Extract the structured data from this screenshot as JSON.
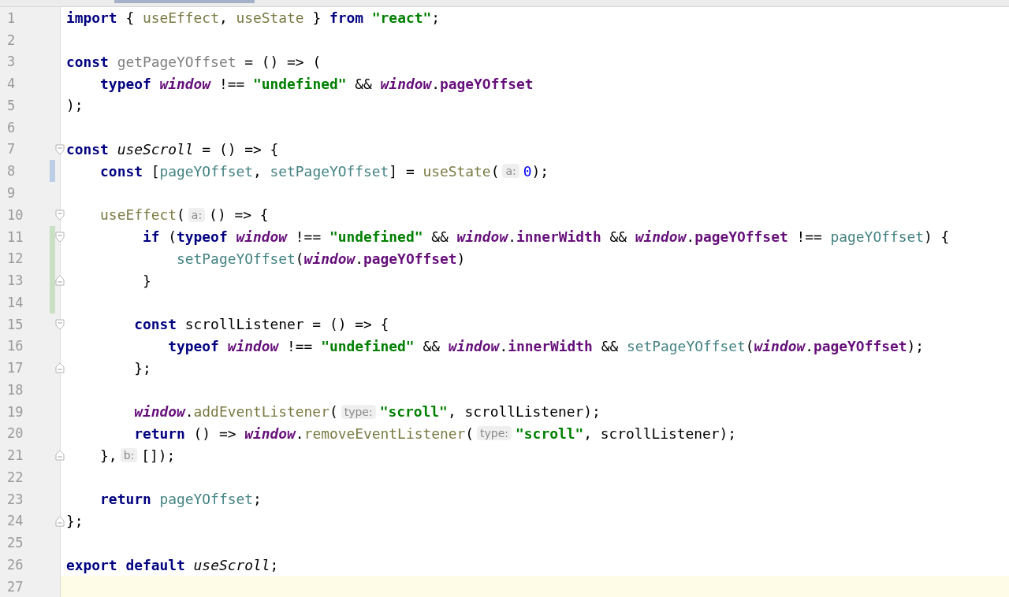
{
  "editor": {
    "lines": [
      {
        "number": "1",
        "tokens": [
          {
            "kind": "keyword",
            "text": "import"
          },
          {
            "kind": "plain",
            "text": " {"
          },
          {
            "kind": "function",
            "text": " useEffect"
          },
          {
            "kind": "plain",
            "text": ","
          },
          {
            "kind": "function",
            "text": " useState"
          },
          {
            "kind": "plain",
            "text": " }"
          },
          {
            "kind": "keyword",
            "text": " from"
          },
          {
            "kind": "string",
            "text": " \"react\""
          },
          {
            "kind": "plain",
            "text": ";"
          }
        ]
      },
      {
        "number": "2"
      },
      {
        "number": "3",
        "tokens": [
          {
            "kind": "keyword",
            "text": "const"
          },
          {
            "kind": "unused",
            "text": " getPageYOffset"
          },
          {
            "kind": "plain",
            "text": " = () => ("
          }
        ]
      },
      {
        "number": "4",
        "tokens": [
          {
            "kind": "keyword",
            "text": "    typeof"
          },
          {
            "kind": "global",
            "text": " window"
          },
          {
            "kind": "plain",
            "text": " !=="
          },
          {
            "kind": "string",
            "text": " \"undefined\""
          },
          {
            "kind": "plain",
            "text": " &&"
          },
          {
            "kind": "global",
            "text": " window"
          },
          {
            "kind": "plain",
            "text": "."
          },
          {
            "kind": "field",
            "text": "pageYOffset"
          }
        ]
      },
      {
        "number": "5",
        "tokens": [
          {
            "kind": "plain",
            "text": ");"
          }
        ]
      },
      {
        "number": "6"
      },
      {
        "number": "7",
        "fold_start": true,
        "tokens": [
          {
            "kind": "keyword",
            "text": "const"
          },
          {
            "kind": "italic",
            "text": " useScroll"
          },
          {
            "kind": "plain",
            "text": " = () => {"
          }
        ]
      },
      {
        "number": "8",
        "modified": true,
        "tokens": [
          {
            "kind": "keyword",
            "text": "    const"
          },
          {
            "kind": "plain",
            "text": " ["
          },
          {
            "kind": "local",
            "text": "pageYOffset"
          },
          {
            "kind": "plain",
            "text": ","
          },
          {
            "kind": "local",
            "text": " setPageYOffset"
          },
          {
            "kind": "plain",
            "text": "] ="
          },
          {
            "kind": "function",
            "text": " useState"
          },
          {
            "kind": "plain",
            "text": "("
          },
          {
            "kind": "hint",
            "text": "a:"
          },
          {
            "kind": "number",
            "text": "0"
          },
          {
            "kind": "plain",
            "text": ");"
          }
        ]
      },
      {
        "number": "9"
      },
      {
        "number": "10",
        "fold_start": true,
        "tokens": [
          {
            "kind": "function",
            "text": "    useEffect"
          },
          {
            "kind": "plain",
            "text": "("
          },
          {
            "kind": "hint",
            "text": "a:"
          },
          {
            "kind": "plain",
            "text": "() => {"
          }
        ]
      },
      {
        "number": "11",
        "added": true,
        "fold_start": true,
        "tokens": [
          {
            "kind": "keyword",
            "text": "         if"
          },
          {
            "kind": "plain",
            "text": " ("
          },
          {
            "kind": "keyword",
            "text": "typeof"
          },
          {
            "kind": "global",
            "text": " window"
          },
          {
            "kind": "plain",
            "text": " !=="
          },
          {
            "kind": "string",
            "text": " \"undefined\""
          },
          {
            "kind": "plain",
            "text": " &&"
          },
          {
            "kind": "global",
            "text": " window"
          },
          {
            "kind": "plain",
            "text": "."
          },
          {
            "kind": "field",
            "text": "innerWidth"
          },
          {
            "kind": "plain",
            "text": " &&"
          },
          {
            "kind": "global",
            "text": " window"
          },
          {
            "kind": "plain",
            "text": "."
          },
          {
            "kind": "field",
            "text": "pageYOffset"
          },
          {
            "kind": "plain",
            "text": " !=="
          },
          {
            "kind": "local",
            "text": " pageYOffset"
          },
          {
            "kind": "plain",
            "text": ") {"
          }
        ]
      },
      {
        "number": "12",
        "added": true,
        "tokens": [
          {
            "kind": "local",
            "text": "             setPageYOffset"
          },
          {
            "kind": "plain",
            "text": "("
          },
          {
            "kind": "global",
            "text": "window"
          },
          {
            "kind": "plain",
            "text": "."
          },
          {
            "kind": "field",
            "text": "pageYOffset"
          },
          {
            "kind": "plain",
            "text": ")"
          }
        ]
      },
      {
        "number": "13",
        "added": true,
        "fold_end": true,
        "tokens": [
          {
            "kind": "plain",
            "text": "         }"
          }
        ]
      },
      {
        "number": "14",
        "added": true
      },
      {
        "number": "15",
        "fold_start": true,
        "tokens": [
          {
            "kind": "keyword",
            "text": "        const"
          },
          {
            "kind": "plain",
            "text": " scrollListener = () => {"
          }
        ]
      },
      {
        "number": "16",
        "tokens": [
          {
            "kind": "keyword",
            "text": "            typeof"
          },
          {
            "kind": "global",
            "text": " window"
          },
          {
            "kind": "plain",
            "text": " !=="
          },
          {
            "kind": "string",
            "text": " \"undefined\""
          },
          {
            "kind": "plain",
            "text": " &&"
          },
          {
            "kind": "global",
            "text": " window"
          },
          {
            "kind": "plain",
            "text": "."
          },
          {
            "kind": "field",
            "text": "innerWidth"
          },
          {
            "kind": "plain",
            "text": " &&"
          },
          {
            "kind": "local",
            "text": " setPageYOffset"
          },
          {
            "kind": "plain",
            "text": "("
          },
          {
            "kind": "global",
            "text": "window"
          },
          {
            "kind": "plain",
            "text": "."
          },
          {
            "kind": "field",
            "text": "pageYOffset"
          },
          {
            "kind": "plain",
            "text": ");"
          }
        ]
      },
      {
        "number": "17",
        "fold_end": true,
        "tokens": [
          {
            "kind": "plain",
            "text": "        };"
          }
        ]
      },
      {
        "number": "18"
      },
      {
        "number": "19",
        "tokens": [
          {
            "kind": "global",
            "text": "        window"
          },
          {
            "kind": "plain",
            "text": "."
          },
          {
            "kind": "function",
            "text": "addEventListener"
          },
          {
            "kind": "plain",
            "text": "("
          },
          {
            "kind": "hint",
            "text": "type:"
          },
          {
            "kind": "string",
            "text": "\"scroll\""
          },
          {
            "kind": "plain",
            "text": ", scrollListener);"
          }
        ]
      },
      {
        "number": "20",
        "tokens": [
          {
            "kind": "keyword",
            "text": "        return"
          },
          {
            "kind": "plain",
            "text": " () =>"
          },
          {
            "kind": "global",
            "text": " window"
          },
          {
            "kind": "plain",
            "text": "."
          },
          {
            "kind": "function",
            "text": "removeEventListener"
          },
          {
            "kind": "plain",
            "text": "("
          },
          {
            "kind": "hint",
            "text": "type:"
          },
          {
            "kind": "string",
            "text": "\"scroll\""
          },
          {
            "kind": "plain",
            "text": ", scrollListener);"
          }
        ]
      },
      {
        "number": "21",
        "fold_end": true,
        "tokens": [
          {
            "kind": "plain",
            "text": "    },"
          },
          {
            "kind": "hint",
            "text": "b:"
          },
          {
            "kind": "plain",
            "text": "[]);"
          }
        ]
      },
      {
        "number": "22"
      },
      {
        "number": "23",
        "tokens": [
          {
            "kind": "keyword",
            "text": "    return"
          },
          {
            "kind": "local",
            "text": " pageYOffset"
          },
          {
            "kind": "plain",
            "text": ";"
          }
        ]
      },
      {
        "number": "24",
        "fold_end": true,
        "tokens": [
          {
            "kind": "plain",
            "text": "};"
          }
        ]
      },
      {
        "number": "25"
      },
      {
        "number": "26",
        "tokens": [
          {
            "kind": "keyword",
            "text": "export"
          },
          {
            "kind": "keyword",
            "text": " default"
          },
          {
            "kind": "italic",
            "text": " useScroll"
          },
          {
            "kind": "plain",
            "text": ";"
          }
        ]
      },
      {
        "number": "27",
        "current": true
      }
    ]
  }
}
